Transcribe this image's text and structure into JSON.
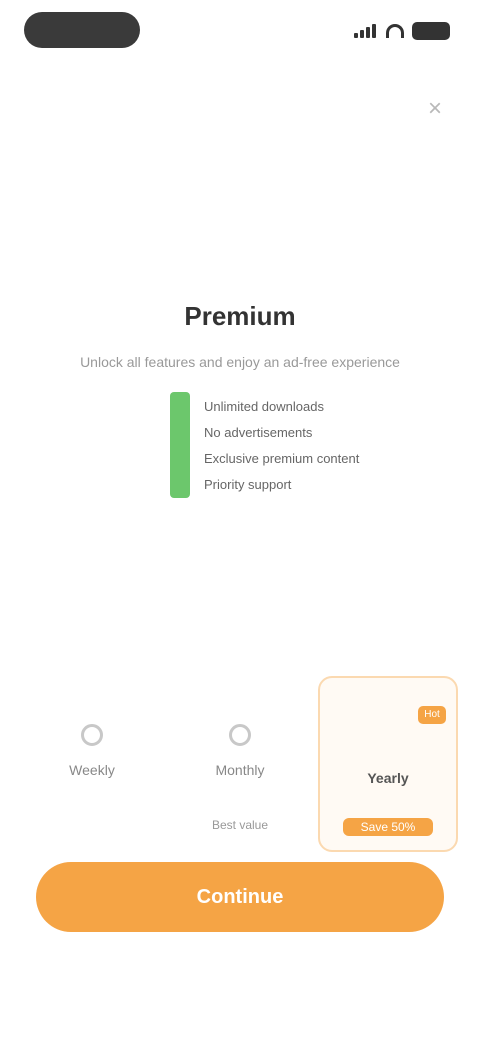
{
  "close_glyph": "×",
  "hero": {
    "title": "Premium",
    "subtitle": "Unlock all features and enjoy an ad-free experience"
  },
  "features": [
    "Unlimited downloads",
    "No advertisements",
    "Exclusive premium content",
    "Priority support"
  ],
  "plans": [
    {
      "name": "Weekly",
      "price": ""
    },
    {
      "name": "Monthly",
      "price": "Best value"
    },
    {
      "name": "Yearly",
      "price": "Save 50%",
      "badge": "Hot"
    }
  ],
  "cta": {
    "label": "Continue"
  },
  "colors": {
    "accent": "#f5a445",
    "feature_bar": "#6cc76c",
    "selected_border": "#fbd9b0"
  }
}
